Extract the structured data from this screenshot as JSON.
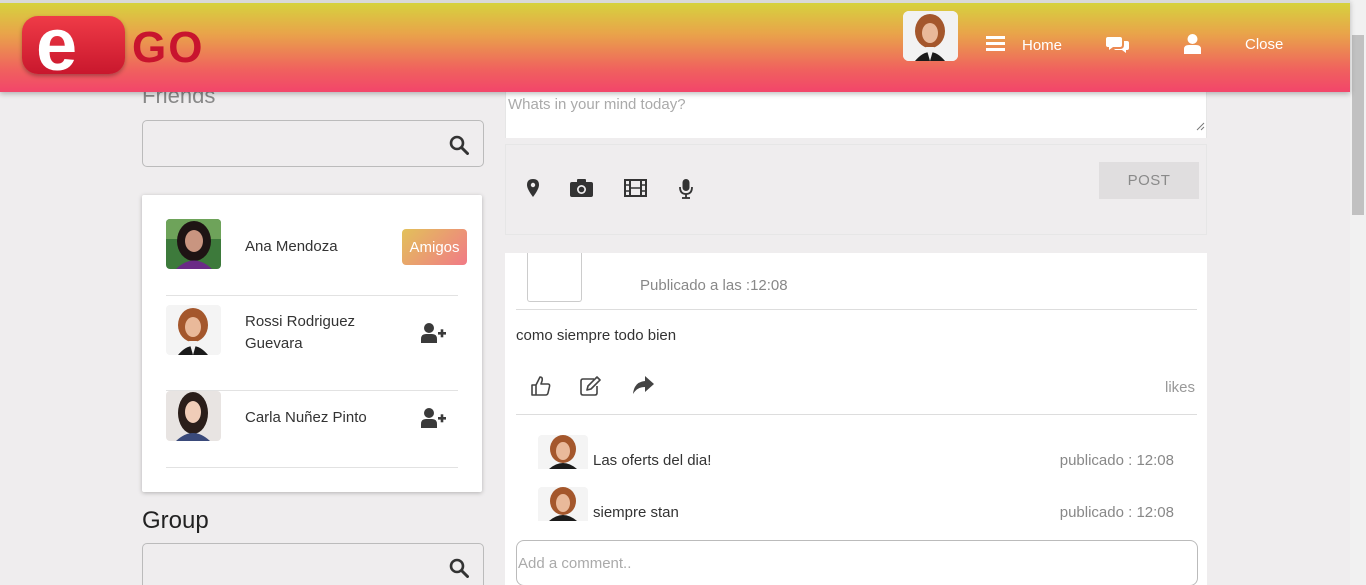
{
  "brand": {
    "logo_letter": "e",
    "logo_word": "GO"
  },
  "nav": {
    "home": "Home",
    "close": "Close"
  },
  "friends": {
    "title": "Friends",
    "list": [
      {
        "name": "Ana Mendoza",
        "action": "Amigos"
      },
      {
        "name": "Rossi Rodriguez Guevara"
      },
      {
        "name": "Carla Nuñez Pinto"
      }
    ]
  },
  "group": {
    "title": "Group"
  },
  "composer": {
    "placeholder": "Whats in your mind today?",
    "post_label": "POST"
  },
  "post": {
    "time": "Publicado a las :12:08",
    "text": "como siempre todo bien",
    "likes_label": "likes",
    "comments": [
      {
        "text": "Las oferts del dia!",
        "time": "publicado : 12:08"
      },
      {
        "text": "siempre stan",
        "time": "publicado : 12:08"
      }
    ],
    "comment_placeholder": "Add a comment.."
  }
}
